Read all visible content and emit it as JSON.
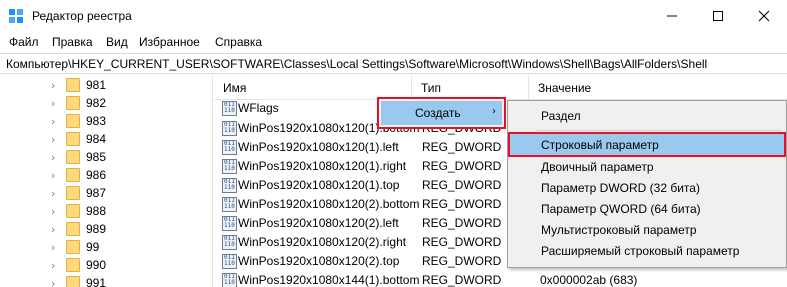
{
  "window": {
    "title": "Редактор реестра",
    "minimize_glyph": "—",
    "maximize_glyph": "☐",
    "close_glyph": "✕"
  },
  "menu": [
    "Файл",
    "Правка",
    "Вид",
    "Избранное",
    "Справка"
  ],
  "address": "Компьютер\\HKEY_CURRENT_USER\\SOFTWARE\\Classes\\Local Settings\\Software\\Microsoft\\Windows\\Shell\\Bags\\AllFolders\\Shell",
  "tree": {
    "items": [
      "981",
      "982",
      "983",
      "984",
      "985",
      "986",
      "987",
      "988",
      "989",
      "99",
      "990",
      "991"
    ]
  },
  "columns": {
    "name": "Имя",
    "type": "Тип",
    "data": "Значение"
  },
  "values": [
    {
      "icon": "binary",
      "name": "WFlags",
      "type": "",
      "data": ""
    },
    {
      "icon": "binary",
      "name": "WinPos1920x1080x120(1).bottom",
      "type": "REG_DWORD",
      "data": ""
    },
    {
      "icon": "binary",
      "name": "WinPos1920x1080x120(1).left",
      "type": "REG_DWORD",
      "data": ""
    },
    {
      "icon": "binary",
      "name": "WinPos1920x1080x120(1).right",
      "type": "REG_DWORD",
      "data": ""
    },
    {
      "icon": "binary",
      "name": "WinPos1920x1080x120(1).top",
      "type": "REG_DWORD",
      "data": ""
    },
    {
      "icon": "binary",
      "name": "WinPos1920x1080x120(2).bottom",
      "type": "REG_DWORD",
      "data": ""
    },
    {
      "icon": "binary",
      "name": "WinPos1920x1080x120(2).left",
      "type": "REG_DWORD",
      "data": ""
    },
    {
      "icon": "binary",
      "name": "WinPos1920x1080x120(2).right",
      "type": "REG_DWORD",
      "data": ""
    },
    {
      "icon": "binary",
      "name": "WinPos1920x1080x120(2).top",
      "type": "REG_DWORD",
      "data": ""
    },
    {
      "icon": "binary",
      "name": "WinPos1920x1080x144(1).bottom",
      "type": "REG_DWORD",
      "data": "0x000002ab (683)"
    }
  ],
  "context_menu": {
    "create_label": "Создать",
    "submenu": [
      "Раздел",
      "Строковый параметр",
      "Двоичный параметр",
      "Параметр DWORD (32 бита)",
      "Параметр QWORD (64 бита)",
      "Мультистроковый параметр",
      "Расширяемый строковый параметр"
    ]
  },
  "colors": {
    "highlight": "#99c9ef",
    "red_outline": "#e81123",
    "folder": "#ffd97a"
  }
}
